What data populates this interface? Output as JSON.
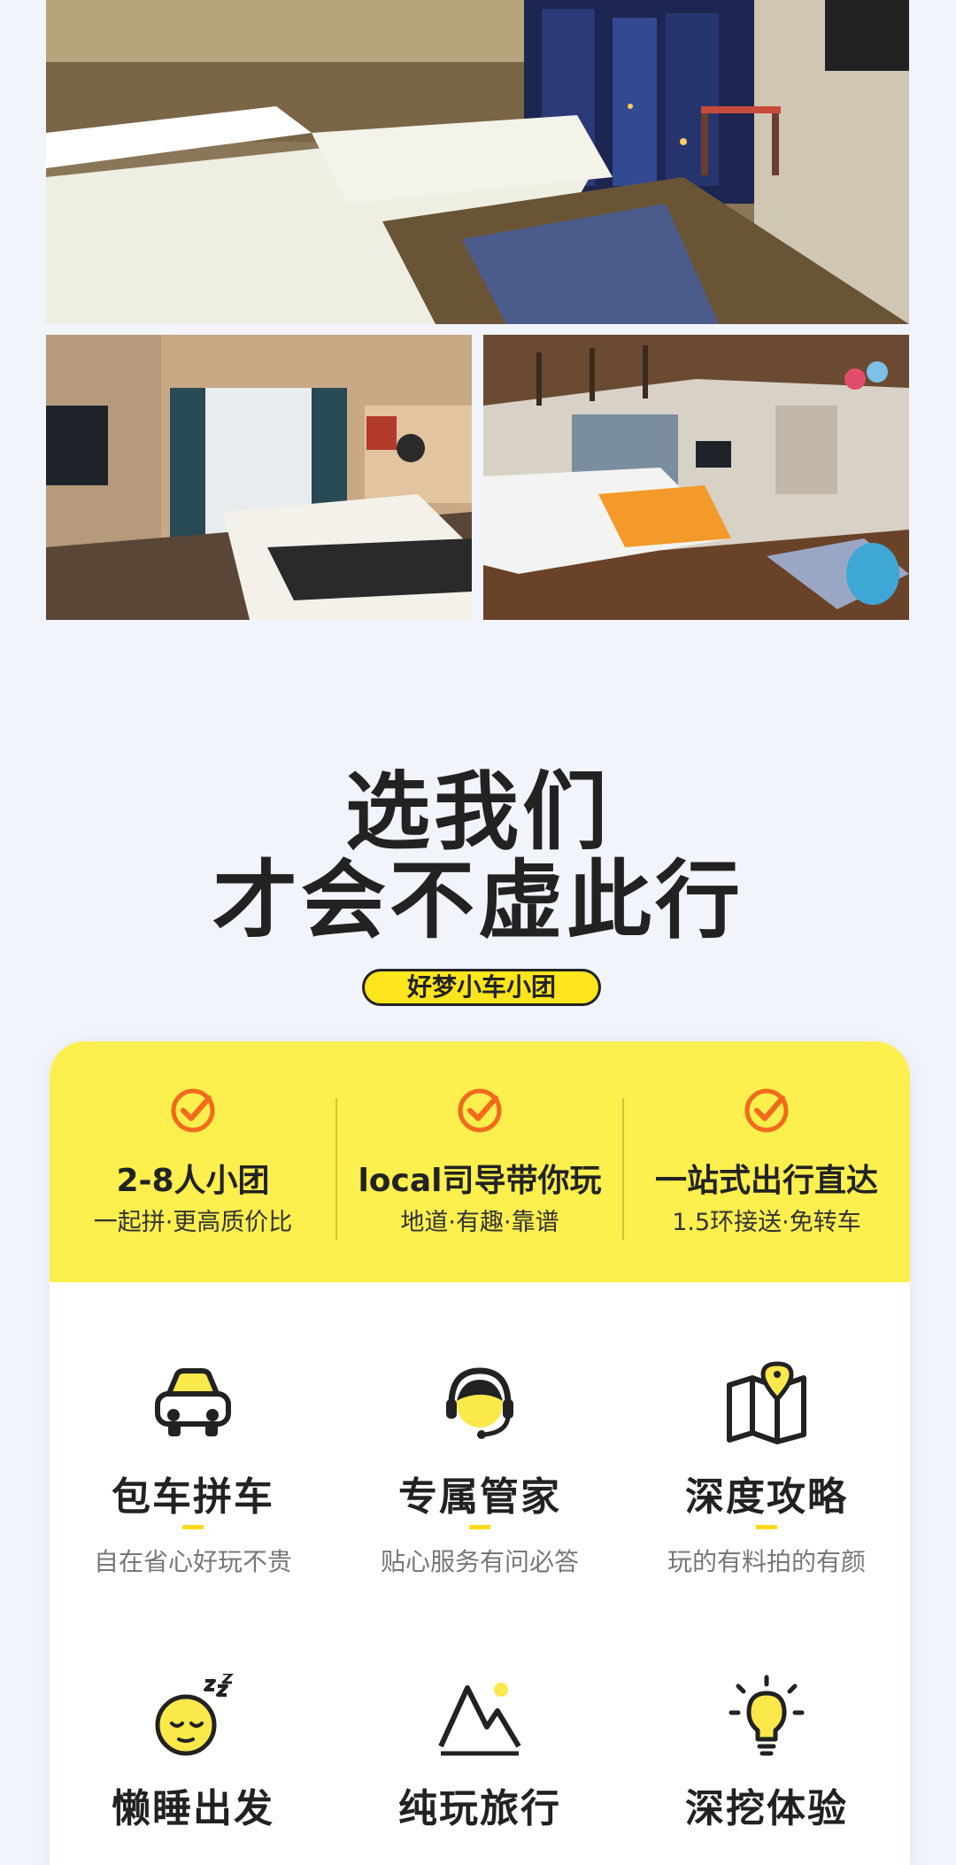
{
  "headline": {
    "line1": "选我们",
    "line2": "才会不虚此行"
  },
  "brand_badge": "好梦小车小团",
  "features": [
    {
      "title": "2-8人小团",
      "subtitle": "一起拼·更高质价比"
    },
    {
      "title": "local司导带你玩",
      "subtitle": "地道·有趣·靠谱"
    },
    {
      "title": "一站式出行直达",
      "subtitle": "1.5环接送·免转车"
    }
  ],
  "services": [
    {
      "icon": "car-icon",
      "title": "包车拼车",
      "desc": "自在省心好玩不贵"
    },
    {
      "icon": "headset-agent-icon",
      "title": "专属管家",
      "desc": "贴心服务有问必答"
    },
    {
      "icon": "map-pin-icon",
      "title": "深度攻略",
      "desc": "玩的有料拍的有颜"
    },
    {
      "icon": "sleeping-face-icon",
      "title": "懒睡出发",
      "desc": ""
    },
    {
      "icon": "mountain-icon",
      "title": "纯玩旅行",
      "desc": ""
    },
    {
      "icon": "lightbulb-icon",
      "title": "深挖体验",
      "desc": ""
    }
  ],
  "colors": {
    "accent_yellow": "#fcef4e",
    "badge_yellow": "#ffe51c",
    "check_orange": "#f26a1b",
    "text_dark": "#222222"
  }
}
